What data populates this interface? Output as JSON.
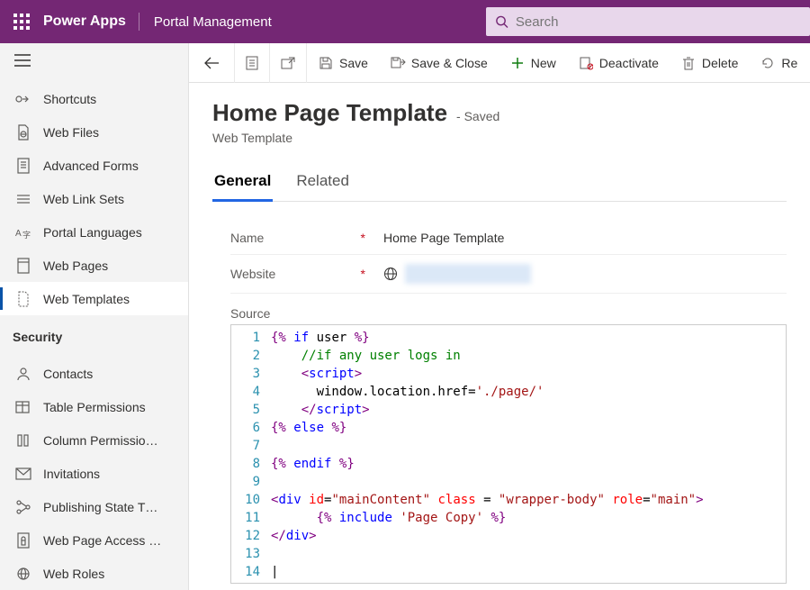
{
  "header": {
    "brand": "Power Apps",
    "area": "Portal Management",
    "search_placeholder": "Search"
  },
  "sidebar": {
    "group1": [
      {
        "icon": "shortcuts",
        "label": "Shortcuts"
      },
      {
        "icon": "webfiles",
        "label": "Web Files"
      },
      {
        "icon": "advforms",
        "label": "Advanced Forms"
      },
      {
        "icon": "weblinks",
        "label": "Web Link Sets"
      },
      {
        "icon": "languages",
        "label": "Portal Languages"
      },
      {
        "icon": "webpages",
        "label": "Web Pages"
      },
      {
        "icon": "webtemplates",
        "label": "Web Templates",
        "active": true
      }
    ],
    "securityTitle": "Security",
    "group2": [
      {
        "icon": "contacts",
        "label": "Contacts"
      },
      {
        "icon": "tableperm",
        "label": "Table Permissions"
      },
      {
        "icon": "columnperm",
        "label": "Column Permissio…"
      },
      {
        "icon": "invitations",
        "label": "Invitations"
      },
      {
        "icon": "pubstate",
        "label": "Publishing State T…"
      },
      {
        "icon": "webpageaccess",
        "label": "Web Page Access …"
      },
      {
        "icon": "webroles",
        "label": "Web Roles"
      }
    ]
  },
  "commands": {
    "back": "Back",
    "save": "Save",
    "saveClose": "Save & Close",
    "new": "New",
    "deactivate": "Deactivate",
    "delete": "Delete",
    "refresh": "Re"
  },
  "record": {
    "title": "Home Page Template",
    "state": "- Saved",
    "entity": "Web Template",
    "tabs": {
      "general": "General",
      "related": "Related"
    },
    "fields": {
      "nameLabel": "Name",
      "nameValue": "Home Page Template",
      "websiteLabel": "Website",
      "sourceLabel": "Source"
    },
    "source_lines": [
      {
        "n": 1,
        "html": "<span class='punct'>{%</span> <span class='kw'>if</span> user <span class='punct'>%}</span>"
      },
      {
        "n": 2,
        "html": "    <span class='cm'>//if any user logs in</span>"
      },
      {
        "n": 3,
        "html": "    <span class='punct'>&lt;</span><span class='kw'>script</span><span class='punct'>&gt;</span>"
      },
      {
        "n": 4,
        "html": "      window.location.href=<span class='str'>'./page/'</span>"
      },
      {
        "n": 5,
        "html": "    <span class='punct'>&lt;/</span><span class='kw'>script</span><span class='punct'>&gt;</span>"
      },
      {
        "n": 6,
        "html": "<span class='punct'>{%</span> <span class='kw'>else</span> <span class='punct'>%}</span>"
      },
      {
        "n": 7,
        "html": ""
      },
      {
        "n": 8,
        "html": "<span class='punct'>{%</span> <span class='kw'>endif</span> <span class='punct'>%}</span>"
      },
      {
        "n": 9,
        "html": ""
      },
      {
        "n": 10,
        "html": "<span class='punct'>&lt;</span><span class='kw'>div</span> <span class='attr'>id</span>=<span class='str'>\"mainContent\"</span> <span class='attr'>class </span>= <span class='str'>\"wrapper-body\"</span> <span class='attr'>role</span>=<span class='str'>\"main\"</span><span class='punct'>&gt;</span>"
      },
      {
        "n": 11,
        "html": "      <span class='punct'>{%</span> <span class='kw'>include</span> <span class='str'>'Page Copy'</span> <span class='punct'>%}</span>"
      },
      {
        "n": 12,
        "html": "<span class='punct'>&lt;/</span><span class='kw'>div</span><span class='punct'>&gt;</span>"
      },
      {
        "n": 13,
        "html": ""
      },
      {
        "n": 14,
        "html": "<span class='cursor-caret'>|</span>"
      }
    ]
  }
}
